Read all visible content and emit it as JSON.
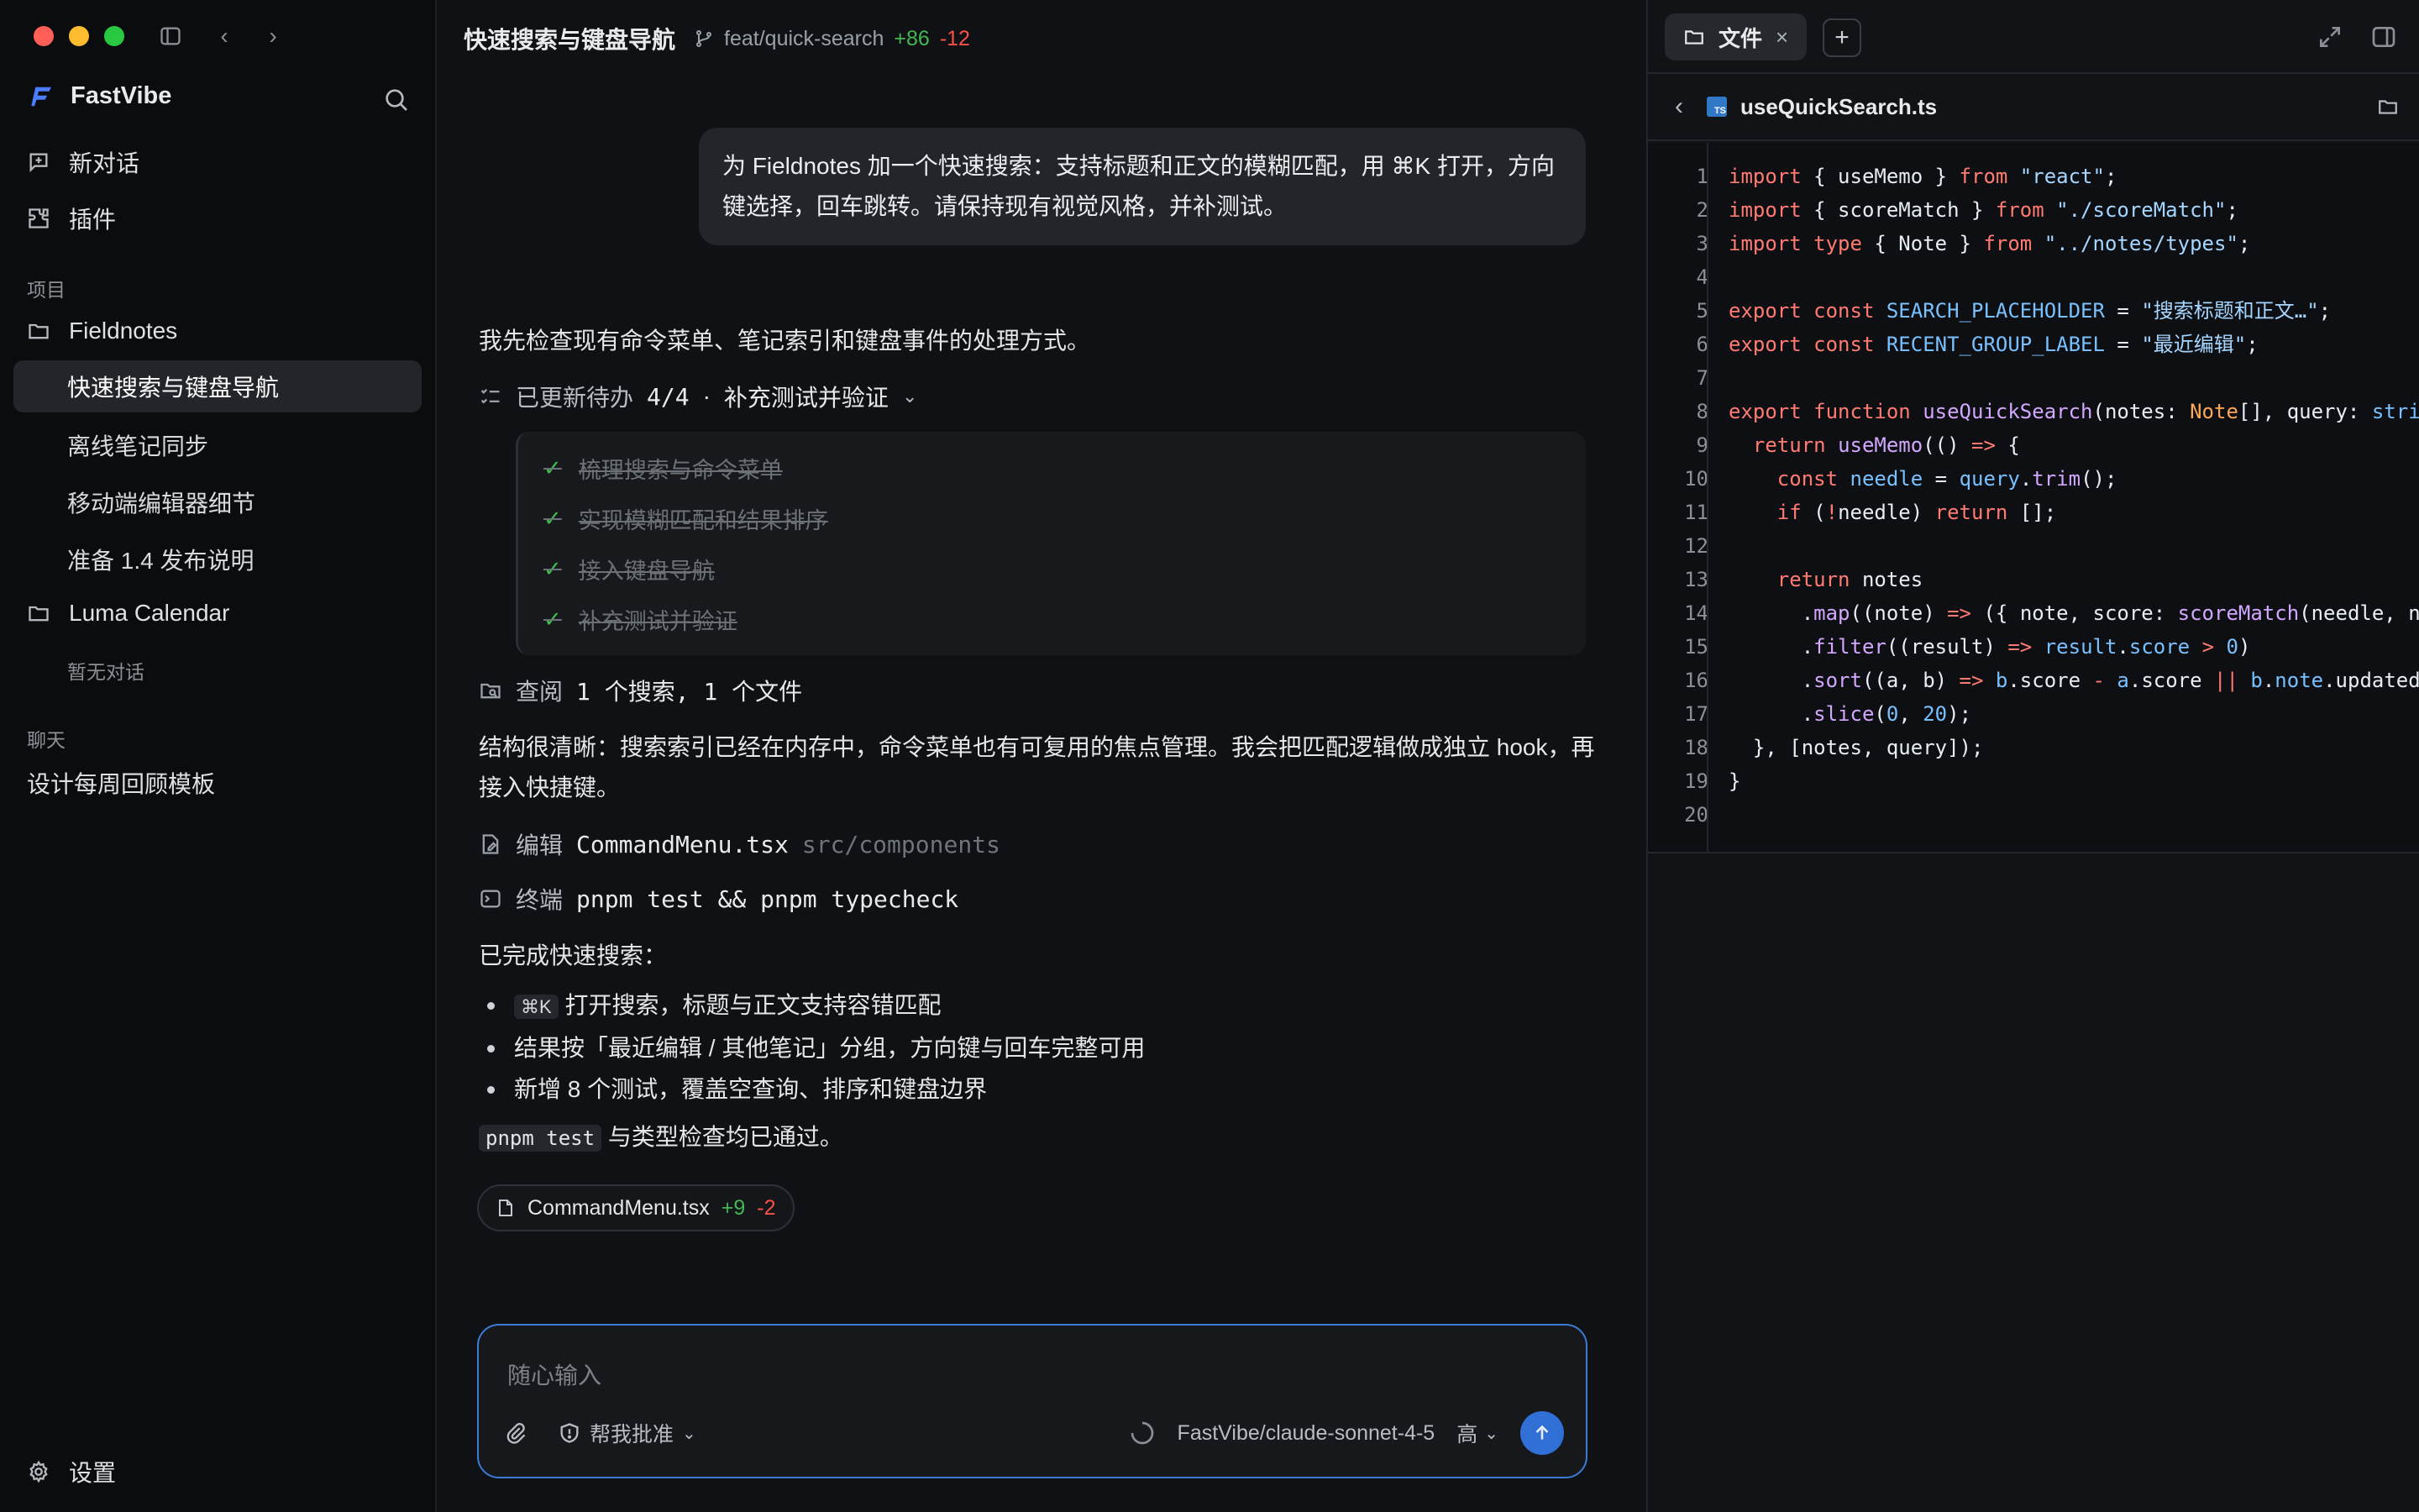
{
  "app": {
    "name": "FastVibe",
    "colors": {
      "accent": "#3b82f6",
      "added": "#3fb950",
      "removed": "#f85149"
    }
  },
  "sidebar": {
    "new_chat": "新对话",
    "plugins": "插件",
    "projects_label": "项目",
    "projects": [
      {
        "name": "Fieldnotes",
        "items": [
          "快速搜索与键盘导航",
          "离线笔记同步",
          "移动端编辑器细节",
          "准备 1.4 发布说明"
        ]
      },
      {
        "name": "Luma Calendar",
        "empty": "暂无对话"
      }
    ],
    "chats_label": "聊天",
    "chats": [
      "设计每周回顾模板"
    ],
    "settings": "设置"
  },
  "header": {
    "title": "快速搜索与键盘导航",
    "branch": "feat/quick-search",
    "added": "+86",
    "removed": "-12"
  },
  "conversation": {
    "user_message": "为 Fieldnotes 加一个快速搜索：支持标题和正文的模糊匹配，用 ⌘K 打开，方向键选择，回车跳转。请保持现有视觉风格，并补测试。",
    "intro": "我先检查现有命令菜单、笔记索引和键盘事件的处理方式。",
    "todo_header": {
      "label": "已更新待办",
      "count": "4/4",
      "sep": "·",
      "current": "补充测试并验证"
    },
    "todos": [
      "梳理搜索与命令菜单",
      "实现模糊匹配和结果排序",
      "接入键盘导航",
      "补充测试并验证"
    ],
    "review": {
      "label": "查阅",
      "detail": "1 个搜索, 1 个文件"
    },
    "analysis": "结构很清晰：搜索索引已经在内存中，命令菜单也有可复用的焦点管理。我会把匹配逻辑做成独立 hook，再接入快捷键。",
    "edit": {
      "label": "编辑",
      "file": "CommandMenu.tsx",
      "path": "src/components"
    },
    "terminal": {
      "label": "终端",
      "command": "pnpm test && pnpm typecheck"
    },
    "summary_title": "已完成快速搜索：",
    "summary_items": [
      {
        "kbd": "⌘K",
        "text": "打开搜索，标题与正文支持容错匹配"
      },
      {
        "text": "结果按「最近编辑 / 其他笔记」分组，方向键与回车完整可用"
      },
      {
        "text": "新增 8 个测试，覆盖空查询、排序和键盘边界"
      }
    ],
    "final_code": "pnpm test",
    "final_text": "与类型检查均已通过。",
    "file_chip": {
      "name": "CommandMenu.tsx",
      "added": "+9",
      "removed": "-2"
    }
  },
  "composer": {
    "placeholder": "随心输入",
    "approval": "帮我批准",
    "model": "FastVibe/claude-sonnet-4-5",
    "effort": "高"
  },
  "files_panel": {
    "tab_label": "文件",
    "filename": "useQuickSearch.ts",
    "line_numbers": [
      "1",
      "2",
      "3",
      "4",
      "5",
      "6",
      "7",
      "8",
      "9",
      "10",
      "11",
      "12",
      "13",
      "14",
      "15",
      "16",
      "17",
      "18",
      "19",
      "20"
    ],
    "code": {
      "l5_const": "SEARCH_PLACEHOLDER",
      "l5_str": "\"搜索标题和正文…\"",
      "l6_const": "RECENT_GROUP_LABEL",
      "l6_str": "\"最近编辑\""
    }
  }
}
